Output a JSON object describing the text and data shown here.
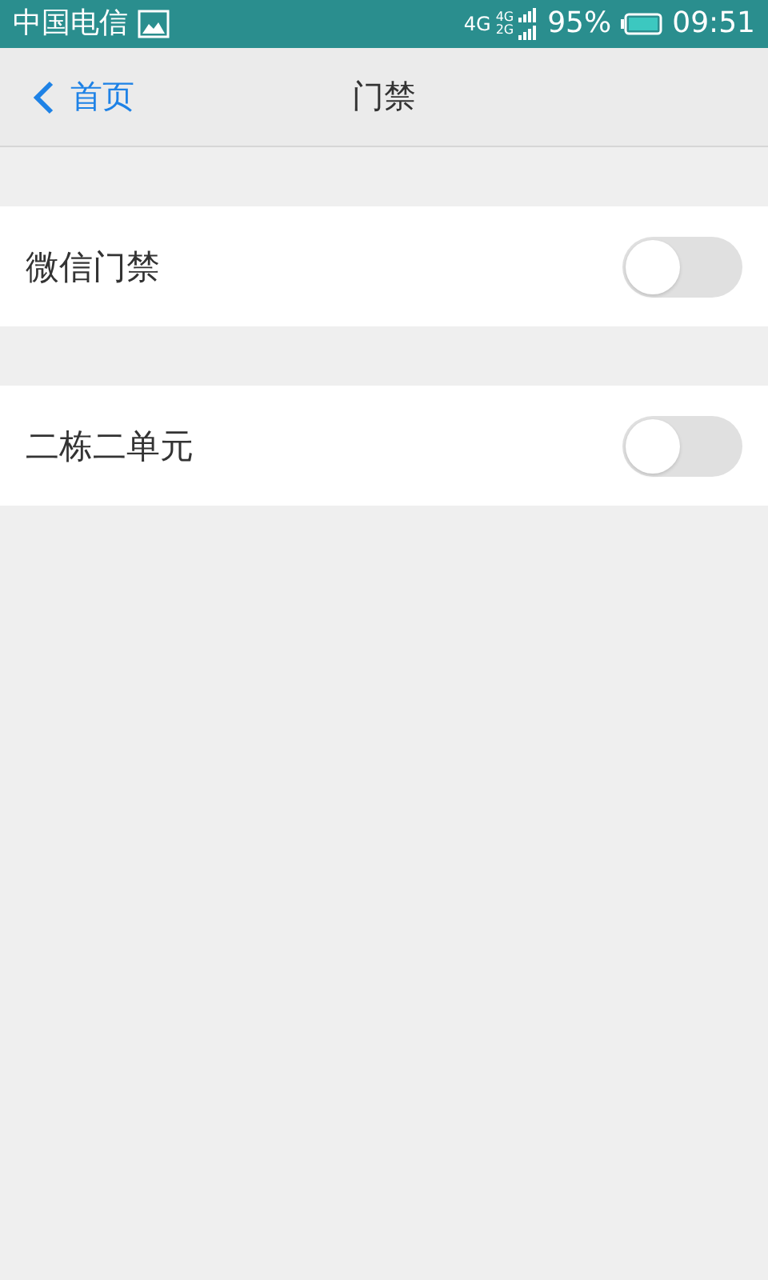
{
  "status_bar": {
    "carrier": "中国电信",
    "network": [
      "4G",
      "4G",
      "2G"
    ],
    "battery": "95%",
    "time": "09:51"
  },
  "nav": {
    "back": "首页",
    "title": "门禁"
  },
  "settings": [
    {
      "label": "微信门禁",
      "on": false
    },
    {
      "label": "二栋二单元",
      "on": false
    }
  ]
}
